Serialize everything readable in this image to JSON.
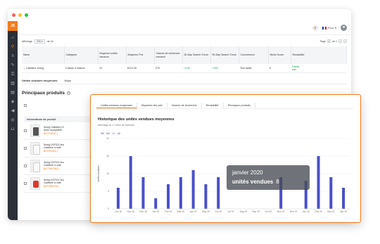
{
  "window": {
    "dots": [
      "#ff5f57",
      "#febc2e",
      "#28c840"
    ],
    "logo": "JS"
  },
  "topbar": {
    "language": "Fran",
    "avatar_glyph": "👤"
  },
  "controls": {
    "show_label": "Affichage",
    "show_value": "200 ▾",
    "of_label": "de 34",
    "page_label": "Page",
    "page_value": "1",
    "page_of": "de 1"
  },
  "table": {
    "headers": [
      "Niche",
      "Catégorie",
      "Moyenne unités vendues",
      "Moyenne Prix",
      "Volume de recherche mensuel",
      "30-Day Search Trend",
      "90-Day Search Trend",
      "Concurrence",
      "Niche Score",
      "Rentabilité"
    ],
    "row": [
      "⌄ Cafetière Smeg",
      "Cuisine & Maison",
      "12",
      "€213,30",
      "270",
      "↑10%",
      "↑30%",
      "Très faible",
      "6",
      "Faible-"
    ],
    "row_extra": "bas"
  },
  "subtabs": [
    "Unités vendues moyennes",
    "Moye"
  ],
  "products_section": {
    "title": "Principaux produits",
    "info_header": "Informations de produit",
    "items": [
      {
        "line1": "Smeg Cafetière Di",
        "line2": "Acier inoxydable,",
        "asin": "B0CF4KMJ | ",
        "thumb": "dark"
      },
      {
        "line1": "Smeg DCF02Crea",
        "line2": "Cafetière à café",
        "asin": "B07HF6XN | ",
        "thumb": "white"
      },
      {
        "line1": "Smeg DCF02Creu",
        "line2": "Cafetière à café",
        "asin": "B07T69CWQ | ",
        "thumb": "white"
      },
      {
        "line1": "Smeg DCF02Creu",
        "line2": "Cafetière à café",
        "asin": "B07HR9EX9 | ",
        "thumb": "red"
      }
    ]
  },
  "panel": {
    "tabs": [
      "Unités vendues moyennes",
      "Moyenne des prix",
      "Volume de recherche",
      "Rentabilité",
      "Principaux produits"
    ],
    "active_tab": 0,
    "tooltip": {
      "date": "janvier 2020",
      "label": "unités vendues",
      "value": "8"
    }
  },
  "chart_data": {
    "type": "bar",
    "title": "Historique des unités vendues moyennes",
    "subtitle": "Affichage de 17 Mois de données",
    "ylabel": "unités vendues",
    "legend_ranges": [
      "3M",
      "6M",
      "1Y",
      "All"
    ],
    "categories": [
      "Oct 18",
      "Nov 18",
      "Dec 18",
      "Jan 19",
      "Feb 19",
      "Mar 19",
      "Apr 19",
      "May 19",
      "Jun 19",
      "Jul 19",
      "Aug 19",
      "Sep 19",
      "Oct 19",
      "Nov 19",
      "Dec 19",
      "Jan 20",
      "Feb 20",
      "Mar 20",
      "Apr 20"
    ],
    "values": [
      6,
      15,
      9,
      3,
      7,
      9,
      11,
      7,
      9,
      0,
      0,
      0,
      0,
      9,
      0,
      8,
      15,
      9,
      6
    ],
    "ylim": [
      0,
      20
    ],
    "yticks": [
      0,
      5,
      10,
      15,
      20
    ],
    "bar_color": "#4a4fc9"
  }
}
